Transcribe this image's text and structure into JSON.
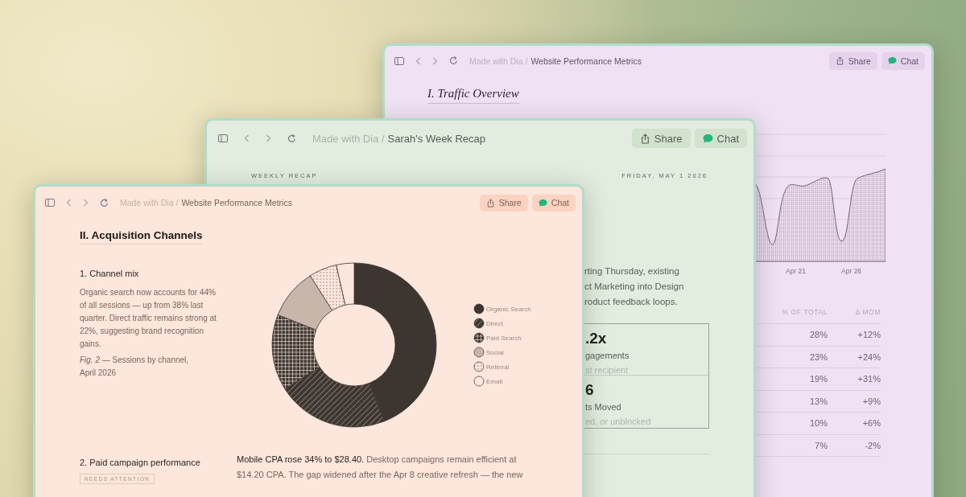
{
  "back_window": {
    "breadcrumb_prefix": "Made with Dia /",
    "title": "Website Performance Metrics",
    "buttons": [
      {
        "kind": "share",
        "label": "Share"
      },
      {
        "kind": "chat",
        "label": "Chat"
      }
    ],
    "heading": "I. Traffic Overview",
    "chart_x_labels": [
      "Apr 21",
      "Apr 26"
    ],
    "table": {
      "columns": [
        "% OF TOTAL",
        "Δ MOM"
      ],
      "rows": [
        [
          "28%",
          "+12%"
        ],
        [
          "23%",
          "+24%"
        ],
        [
          "19%",
          "+31%"
        ],
        [
          "13%",
          "+9%"
        ],
        [
          "10%",
          "+6%"
        ],
        [
          "7%",
          "-2%"
        ]
      ]
    }
  },
  "middle_window": {
    "breadcrumb_prefix": "Made with Dia /",
    "title": "Sarah's Week Recap",
    "buttons": [
      {
        "kind": "share",
        "label": "Share"
      },
      {
        "kind": "chat",
        "label": "Chat"
      }
    ],
    "kicker": "WEEKLY RECAP",
    "date": "FRIDAY, MAY 1 2026",
    "paragraph_lines": [
      "rting Thursday, existing",
      "ct Marketing into Design",
      "roduct feedback loops."
    ],
    "stats": [
      {
        "value": ".2x",
        "label": "gagements",
        "note": "st recipient"
      },
      {
        "value": "6",
        "label": "ts Moved",
        "note": "ed, or unblocked"
      }
    ]
  },
  "front_window": {
    "breadcrumb_prefix": "Made with Dia /",
    "title": "Website Performance Metrics",
    "buttons": [
      {
        "kind": "share",
        "label": "Share"
      },
      {
        "kind": "chat",
        "label": "Chat"
      }
    ],
    "heading": "II. Acquisition Channels",
    "channel_mix": {
      "title": "1. Channel mix",
      "body": "Organic search now accounts for 44% of all sessions — up from 38% last quarter. Direct traffic remains strong at 22%, suggesting brand recognition gains.",
      "caption": "*Fig. 2* — Sessions by channel, April 2026",
      "legend": [
        {
          "kind": "solid",
          "label": "Organic Search"
        },
        {
          "kind": "hatched",
          "label": "Direct"
        },
        {
          "kind": "grid",
          "label": "Paid Search"
        },
        {
          "kind": "shaded",
          "label": "Social"
        },
        {
          "kind": "dotted",
          "label": "Referral"
        },
        {
          "kind": "empty",
          "label": "Email"
        }
      ]
    },
    "paid_campaign": {
      "title": "2. Paid campaign performance",
      "badge": "NEEDS ATTENTION",
      "body": "**Mobile CPA rose 34% to $28.40.** Desktop campaigns remain efficient at $14.20 CPA. The gap widened after the Apr 8 creative refresh — the new"
    }
  }
}
